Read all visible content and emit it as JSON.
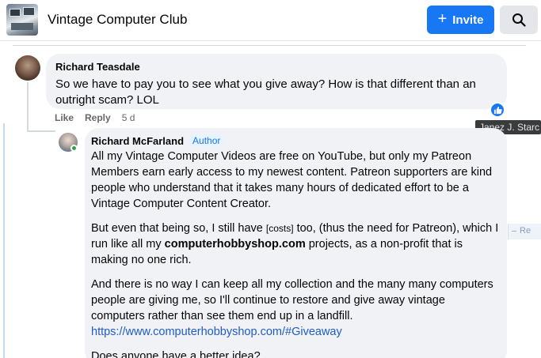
{
  "header": {
    "group_name": "Vintage Computer Club",
    "invite_label": "Invite",
    "icons": {
      "invite": "plus-icon",
      "search": "search-icon"
    },
    "accent_color": "#1877f2"
  },
  "comment": {
    "author": "Richard Teasdale",
    "text": "So we have to pay you to see what you give away? How is that different than an outright scam? LOL",
    "reaction": "like-icon",
    "actions": {
      "like": "Like",
      "reply": "Reply",
      "time": "5 d"
    }
  },
  "tooltip": {
    "text": "Janez J. Starc"
  },
  "reply": {
    "author": "Richard McFarland",
    "badge": "Author",
    "p1": "All my Vintage Computer Videos are free on YouTube, but only my Patreon Members earn early access to my newest content. Patreon supporters are kind people who understand that it takes many hours of dedicated effort to be a Vintage Computer Content Creator.",
    "p2_a": "But even that being so, I still have ",
    "p2_costs": "[costs]",
    "p2_b": " too, (thus the need for Patreon), which I run like all my ",
    "p2_bold": "computerhobbyshop.com",
    "p2_c": " projects, as a non-profit that is making no one rich.",
    "p3": "And there is no way I can keep all my collection and the many many computers people are giving me, so I'll continue to restore and give away vintage computers rather than see them end up in a landfill.",
    "p3_link": "https://www.computerhobbyshop.com/#Giveaway",
    "p4": "Does anyone have a better idea?"
  },
  "side_fragment": {
    "text": "Re"
  }
}
